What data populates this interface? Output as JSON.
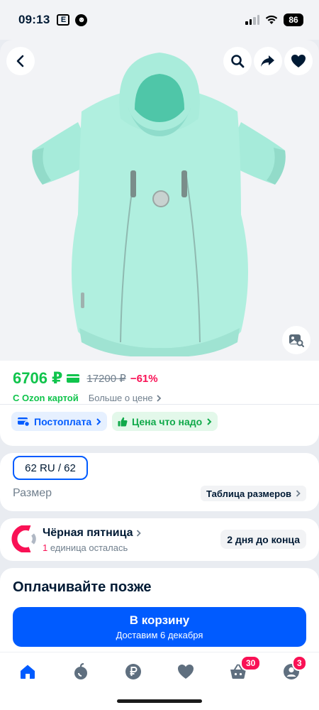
{
  "status_bar": {
    "time": "09:13",
    "notif_letter": "E",
    "battery": "86"
  },
  "product": {
    "price": "6706 ₽",
    "old_price": "17200 ₽",
    "discount": "−61%",
    "ozon_card_text": "С Ozon картой",
    "price_more_text": "Больше о цене",
    "chips": [
      {
        "label": "Постоплата",
        "icon": "card-clock-icon"
      },
      {
        "label": "Цена что надо",
        "icon": "thumb-up-icon"
      }
    ]
  },
  "size": {
    "selected": "62 RU / 62",
    "label": "Размер",
    "table_link": "Таблица размеров"
  },
  "promo": {
    "title": "Чёрная пятница",
    "count": "1",
    "remaining_text": " единица осталась",
    "badge": "2 дня до конца"
  },
  "pay_later": {
    "title": "Оплачивайте позже"
  },
  "cart_button": {
    "label": "В корзину",
    "delivery": "Доставим 6 декабря"
  },
  "tabbar": {
    "cart_badge": "30",
    "profile_badge": "3",
    "tabs": [
      "home-icon",
      "fresh-icon",
      "ruble-icon",
      "heart-icon",
      "basket-icon",
      "profile-icon"
    ]
  },
  "colors": {
    "accent": "#005bff",
    "price_green": "#10c44c",
    "discount_pink": "#f91155",
    "product": "#a8ecdc"
  }
}
